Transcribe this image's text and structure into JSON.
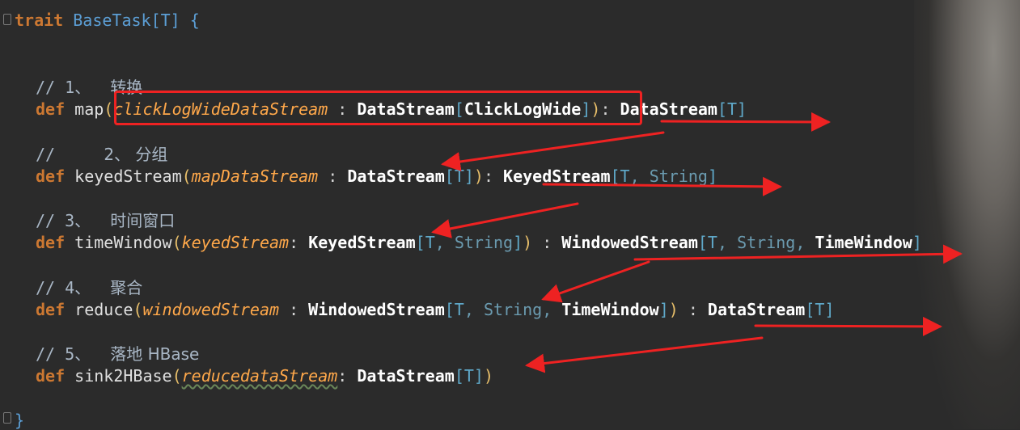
{
  "code": {
    "trait_keyword": "trait",
    "trait_name": "BaseTask",
    "trait_type_param": "[T]",
    "open_brace": "{",
    "close_brace": "}",
    "steps": [
      {
        "comment_prefix": "// 1、",
        "comment_text": "转换",
        "def_kw": "def",
        "fn_name": "map",
        "param_name": "clickLogWideDataStream",
        "sep": " : ",
        "param_type": "DataStream",
        "param_type_arg": "ClickLogWide",
        "return_type": "DataStream",
        "return_type_args": "T"
      },
      {
        "comment_prefix": "//",
        "comment_text": "2、 分组",
        "def_kw": "def",
        "fn_name": "keyedStream",
        "param_name": "mapDataStream",
        "sep": " : ",
        "param_type": "DataStream",
        "param_type_arg": "T",
        "return_type": "KeyedStream",
        "return_type_args_t": "T",
        "return_type_args_str": "String"
      },
      {
        "comment_prefix": "// 3、",
        "comment_text": "时间窗口",
        "def_kw": "def",
        "fn_name": "timeWindow",
        "param_name": "keyedStream",
        "sep": ": ",
        "param_type": "KeyedStream",
        "param_type_arg_t": "T",
        "param_type_arg_str": "String",
        "return_type": "WindowedStream",
        "return_type_args_t": "T",
        "return_type_args_str": "String",
        "return_type_args_win": "TimeWindow"
      },
      {
        "comment_prefix": "// 4、",
        "comment_text": "聚合",
        "def_kw": "def",
        "fn_name": "reduce",
        "param_name": "windowedStream",
        "sep": " : ",
        "param_type": "WindowedStream",
        "param_type_arg_t": "T",
        "param_type_arg_str": "String",
        "param_type_arg_win": "TimeWindow",
        "return_type": "DataStream",
        "return_type_args": "T"
      },
      {
        "comment_prefix": "// 5、",
        "comment_text": "落地 HBase",
        "def_kw": "def",
        "fn_name": "sink2HBase",
        "param_name": "reducedataStream",
        "sep": ": ",
        "param_type": "DataStream",
        "param_type_arg": "T"
      }
    ]
  },
  "colors": {
    "background": "#2b2b2b",
    "keyword": "#cc7832",
    "param": "#ffa84a",
    "type": "#ffffff",
    "type_param": "#5fa8c8",
    "annotation_red": "#ee2222"
  }
}
